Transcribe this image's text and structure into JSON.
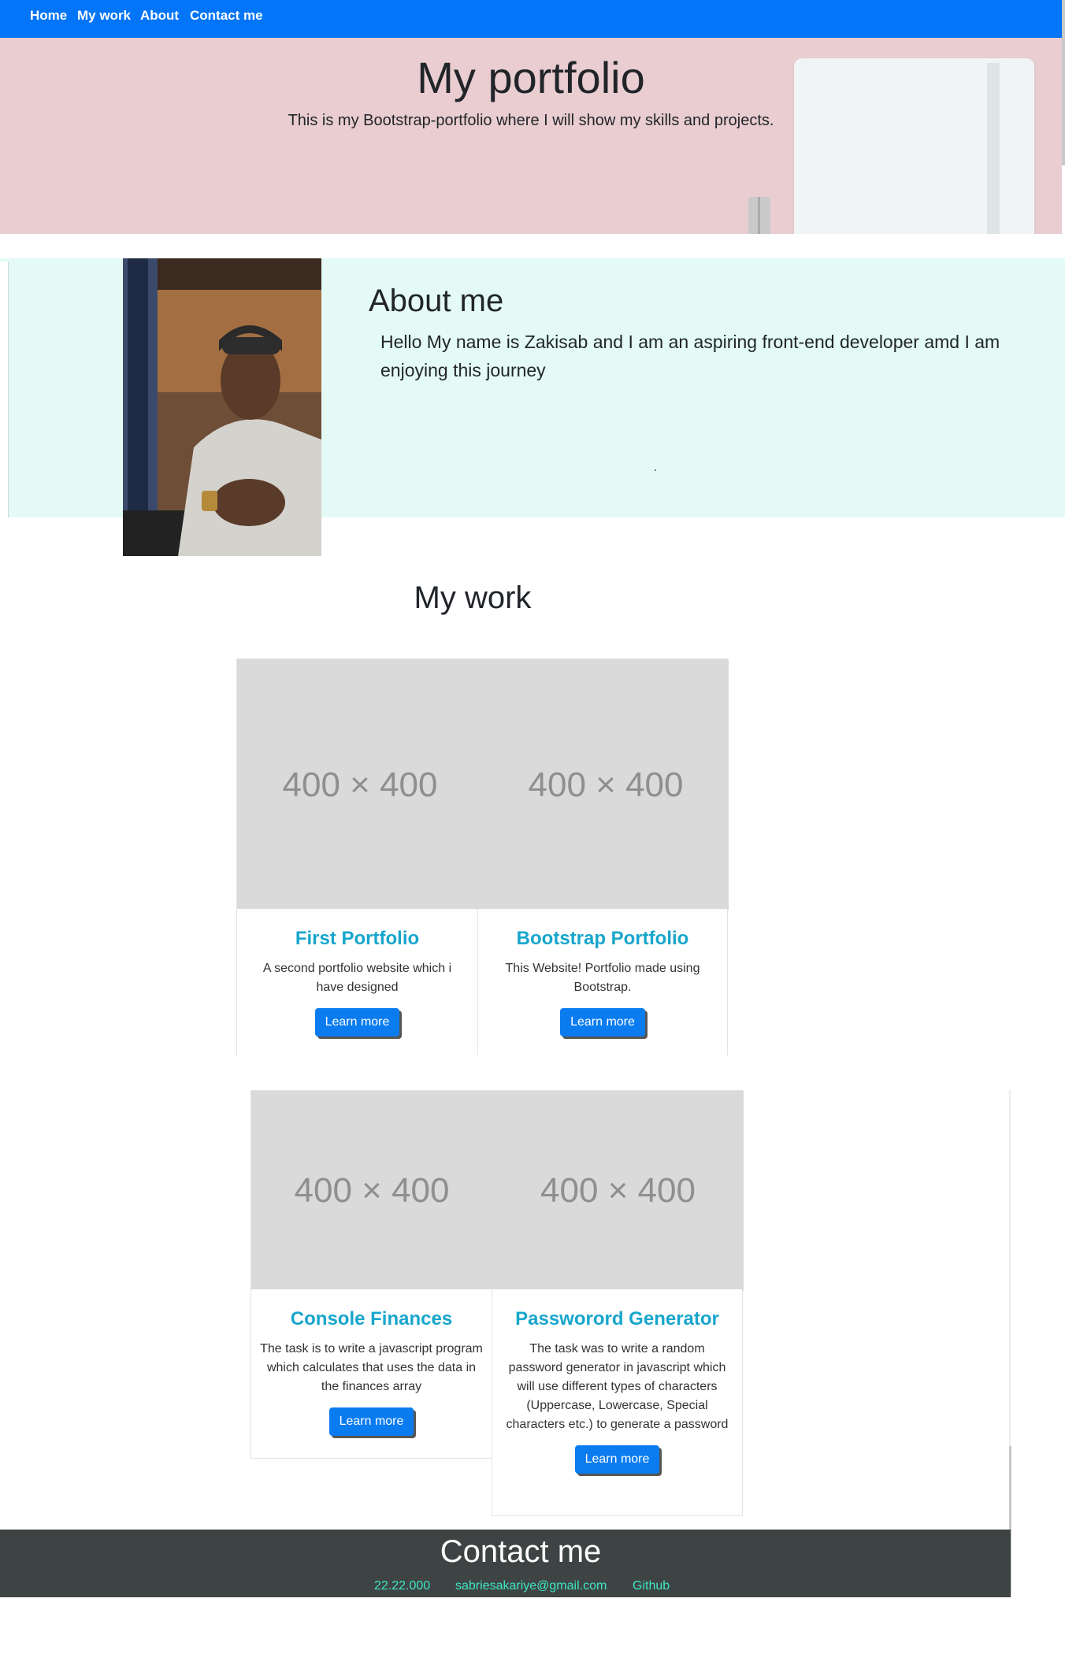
{
  "nav": {
    "home": "Home",
    "work": "My work",
    "about": "About",
    "contact": "Contact me"
  },
  "hero": {
    "title": "My portfolio",
    "subtitle": "This is my Bootstrap-portfolio where I will show my skills and projects."
  },
  "about": {
    "title": "About me",
    "text": "Hello My name is Zakisab and I am an aspiring front-end developer amd I am enjoying this journey",
    "dot": "."
  },
  "work": {
    "title": "My work",
    "projects": [
      {
        "image_text": "400 × 400",
        "title": "First Portfolio",
        "text": "A second portfolio website which i have designed",
        "button": "Learn more"
      },
      {
        "image_text": "400 × 400",
        "title": "Bootstrap Portfolio",
        "text": "This Website! Portfolio made using Bootstrap.",
        "button": "Learn more"
      },
      {
        "image_text": "400 × 400",
        "title": "Console Finances",
        "text": "The task is to write a javascript program which calculates that uses the data in the finances array",
        "button": "Learn more"
      },
      {
        "image_text": "400 × 400",
        "title": "Passworord Generator",
        "text": "The task was to write a random password generator in javascript which will use different types of characters (Uppercase, Lowercase, Special characters etc.) to generate a password",
        "button": "Learn more"
      }
    ]
  },
  "contact": {
    "title": "Contact me",
    "phone": "22.22.000",
    "email": "sabriesakariye@gmail.com",
    "github": "Github"
  },
  "colors": {
    "navbar": "#0275f8",
    "hero_bg": "#e9cdd1",
    "about_bg": "#e4faf6",
    "card_title": "#17a6cc",
    "button": "#0b7cf0",
    "footer_bg": "#3e4444",
    "footer_link": "#3ee8c4"
  }
}
